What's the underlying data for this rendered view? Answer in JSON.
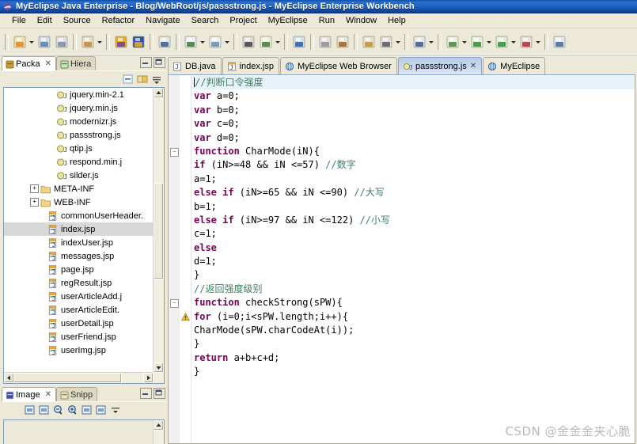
{
  "window": {
    "icon": "eclipse-icon",
    "title": "MyEclipse Java Enterprise - Blog/WebRoot/js/passstrong.js - MyEclipse Enterprise Workbench"
  },
  "menubar": {
    "items": [
      {
        "label": "File"
      },
      {
        "label": "Edit"
      },
      {
        "label": "Source"
      },
      {
        "label": "Refactor"
      },
      {
        "label": "Navigate"
      },
      {
        "label": "Search"
      },
      {
        "label": "Project"
      },
      {
        "label": "MyEclipse"
      },
      {
        "label": "Run"
      },
      {
        "label": "Window"
      },
      {
        "label": "Help"
      }
    ]
  },
  "toolbar": {
    "groups": [
      {
        "buttons": [
          {
            "name": "new-wizard-button",
            "color": "#f0e0a8",
            "accent": "#e08a20",
            "arrow": true
          },
          {
            "name": "save-button",
            "color": "#cfd8e8",
            "accent": "#5a7fb0",
            "arrow": false
          },
          {
            "name": "print-button",
            "color": "#d8dce4",
            "accent": "#7d8ca0",
            "arrow": false
          }
        ]
      },
      {
        "buttons": [
          {
            "name": "open-type-button",
            "color": "#e8dcc0",
            "accent": "#c08840",
            "arrow": true
          }
        ]
      },
      {
        "buttons": [
          {
            "name": "myeclipse-deploy-button",
            "color": "#e8b020",
            "accent": "#7040a0",
            "arrow": false
          },
          {
            "name": "myeclipse-server-button",
            "color": "#3050a8",
            "accent": "#e8b020",
            "arrow": false
          }
        ]
      },
      {
        "buttons": [
          {
            "name": "open-web-browser-button",
            "color": "#dfe4ee",
            "accent": "#3a5a8c",
            "arrow": false
          }
        ]
      },
      {
        "buttons": [
          {
            "name": "new-java-class-button",
            "color": "#e6eef8",
            "accent": "#3a7a3a",
            "arrow": true
          },
          {
            "name": "new-java-package-button",
            "color": "#e6eef8",
            "accent": "#6a8ab0",
            "arrow": true
          }
        ]
      },
      {
        "buttons": [
          {
            "name": "search-button",
            "color": "#dcdcdc",
            "accent": "#404040",
            "arrow": false
          },
          {
            "name": "next-annotation-button",
            "color": "#e8f0d8",
            "accent": "#3a7a3a",
            "arrow": true
          }
        ]
      },
      {
        "buttons": [
          {
            "name": "globe-button",
            "color": "#cfe0ef",
            "accent": "#2a5f9e",
            "arrow": false
          }
        ]
      },
      {
        "buttons": [
          {
            "name": "back-button",
            "color": "#e0e0e0",
            "accent": "#909090",
            "arrow": false
          },
          {
            "name": "forward-button",
            "color": "#e6e0d0",
            "accent": "#a06020",
            "arrow": false
          }
        ]
      },
      {
        "buttons": [
          {
            "name": "open-perspective-button",
            "color": "#e8e0c8",
            "accent": "#c09030",
            "arrow": false
          },
          {
            "name": "zoom-button",
            "color": "#dcdcdc",
            "accent": "#5a5a5a",
            "arrow": true
          }
        ]
      },
      {
        "buttons": [
          {
            "name": "toggle-mark-occurrences-button",
            "color": "#dfe6f0",
            "accent": "#3a5a8c",
            "arrow": true
          }
        ]
      },
      {
        "buttons": [
          {
            "name": "external-tools-button",
            "color": "#e8f0dc",
            "accent": "#4a8a3a",
            "arrow": true
          },
          {
            "name": "run-button",
            "color": "#dff0d8",
            "accent": "#2f8f2f",
            "arrow": true
          },
          {
            "name": "debug-button",
            "color": "#dff0d8",
            "accent": "#2f8f2f",
            "arrow": true
          },
          {
            "name": "profile-button",
            "color": "#f0dcd8",
            "accent": "#b03030",
            "arrow": true
          }
        ]
      },
      {
        "buttons": [
          {
            "name": "open-task-button",
            "color": "#dfe8f4",
            "accent": "#4a6a9a",
            "arrow": false
          }
        ]
      }
    ]
  },
  "left_panel": {
    "top_view": {
      "tabs": [
        {
          "label": "Packa",
          "icon": "package-explorer-icon",
          "active": true,
          "closable": true
        },
        {
          "label": "Hiera",
          "icon": "hierarchy-icon",
          "active": false,
          "closable": false
        }
      ],
      "controls": [
        {
          "name": "minimize-view-button",
          "glyph": "minimize-icon"
        },
        {
          "name": "maximize-view-button",
          "glyph": "maximize-icon"
        }
      ],
      "view_toolbar": [
        {
          "name": "collapse-all-button",
          "icon": "collapse-all-icon"
        },
        {
          "name": "link-with-editor-button",
          "icon": "link-editor-icon"
        },
        {
          "name": "view-menu-button",
          "icon": "view-menu-icon"
        }
      ],
      "tree": [
        {
          "label": "jquery.min-2.1",
          "icon": "js-file-icon",
          "indent": 5,
          "expander": "none",
          "selected": false
        },
        {
          "label": "jquery.min.js",
          "icon": "js-file-icon",
          "indent": 5,
          "expander": "none",
          "selected": false
        },
        {
          "label": "modernizr.js",
          "icon": "js-file-icon",
          "indent": 5,
          "expander": "none",
          "selected": false
        },
        {
          "label": "passstrong.js",
          "icon": "js-file-icon",
          "indent": 5,
          "expander": "none",
          "selected": false
        },
        {
          "label": "qtip.js",
          "icon": "js-file-icon",
          "indent": 5,
          "expander": "none",
          "selected": false
        },
        {
          "label": "respond.min.j",
          "icon": "js-file-icon",
          "indent": 5,
          "expander": "none",
          "selected": false
        },
        {
          "label": "silder.js",
          "icon": "js-file-icon",
          "indent": 5,
          "expander": "none",
          "selected": false
        },
        {
          "label": "META-INF",
          "icon": "folder-icon",
          "indent": 3,
          "expander": "plus",
          "selected": false
        },
        {
          "label": "WEB-INF",
          "icon": "folder-icon",
          "indent": 3,
          "expander": "plus",
          "selected": false
        },
        {
          "label": "commonUserHeader.",
          "icon": "jsp-file-icon",
          "indent": 4,
          "expander": "none",
          "selected": false
        },
        {
          "label": "index.jsp",
          "icon": "jsp-file-icon",
          "indent": 4,
          "expander": "none",
          "selected": true
        },
        {
          "label": "indexUser.jsp",
          "icon": "jsp-file-icon",
          "indent": 4,
          "expander": "none",
          "selected": false
        },
        {
          "label": "messages.jsp",
          "icon": "jsp-file-icon",
          "indent": 4,
          "expander": "none",
          "selected": false
        },
        {
          "label": "page.jsp",
          "icon": "jsp-file-icon",
          "indent": 4,
          "expander": "none",
          "selected": false
        },
        {
          "label": "regResult.jsp",
          "icon": "jsp-file-icon",
          "indent": 4,
          "expander": "none",
          "selected": false
        },
        {
          "label": "userArticleAdd.j",
          "icon": "jsp-file-icon",
          "indent": 4,
          "expander": "none",
          "selected": false
        },
        {
          "label": "userArticleEdit.",
          "icon": "jsp-file-icon",
          "indent": 4,
          "expander": "none",
          "selected": false
        },
        {
          "label": "userDetail.jsp",
          "icon": "jsp-file-icon",
          "indent": 4,
          "expander": "none",
          "selected": false
        },
        {
          "label": "userFriend.jsp",
          "icon": "jsp-file-icon",
          "indent": 4,
          "expander": "none",
          "selected": false
        },
        {
          "label": "userImg.jsp",
          "icon": "jsp-file-icon",
          "indent": 4,
          "expander": "none",
          "selected": false
        }
      ]
    },
    "bottom_view": {
      "tabs": [
        {
          "label": "Image",
          "icon": "image-view-icon",
          "active": true,
          "closable": true
        },
        {
          "label": "Snipp",
          "icon": "snippets-icon",
          "active": false,
          "closable": false
        }
      ],
      "controls": [
        {
          "name": "minimize-view-button",
          "glyph": "minimize-icon"
        },
        {
          "name": "maximize-view-button",
          "glyph": "maximize-icon"
        }
      ],
      "view_toolbar": [
        {
          "name": "image-properties-button",
          "icon": "properties-icon"
        },
        {
          "name": "fit-image-button",
          "icon": "fit-image-icon"
        },
        {
          "name": "zoom-out-button",
          "icon": "zoom-out-icon"
        },
        {
          "name": "zoom-in-button",
          "icon": "zoom-in-icon"
        },
        {
          "name": "zoom-100-button",
          "icon": "zoom-100-icon"
        },
        {
          "name": "zoom-fit-button",
          "icon": "zoom-fit-icon"
        },
        {
          "name": "view-menu-button",
          "icon": "view-menu-icon"
        }
      ]
    }
  },
  "editor": {
    "tabs": [
      {
        "label": "DB.java",
        "icon": "java-file-icon",
        "active": false,
        "closable": false
      },
      {
        "label": "index.jsp",
        "icon": "jsp-file-icon",
        "active": false,
        "closable": false
      },
      {
        "label": "MyEclipse Web Browser",
        "icon": "web-browser-icon",
        "active": false,
        "closable": false
      },
      {
        "label": "passstrong.js",
        "icon": "js-file-icon",
        "active": true,
        "closable": true
      },
      {
        "label": "MyEclipse",
        "icon": "web-browser-icon",
        "active": false,
        "closable": false
      }
    ],
    "filename": "passstrong.js",
    "code_lines": [
      {
        "current": true,
        "fold": "none",
        "marker": "none",
        "tokens": [
          {
            "t": "//判断口令强度",
            "c": "cm"
          }
        ]
      },
      {
        "current": false,
        "fold": "none",
        "marker": "none",
        "tokens": [
          {
            "t": "var",
            "c": "kw"
          },
          {
            "t": " a=0;",
            "c": "pl"
          }
        ]
      },
      {
        "current": false,
        "fold": "none",
        "marker": "none",
        "tokens": [
          {
            "t": "var",
            "c": "kw"
          },
          {
            "t": " b=0;",
            "c": "pl"
          }
        ]
      },
      {
        "current": false,
        "fold": "none",
        "marker": "none",
        "tokens": [
          {
            "t": "var",
            "c": "kw"
          },
          {
            "t": " c=0;",
            "c": "pl"
          }
        ]
      },
      {
        "current": false,
        "fold": "none",
        "marker": "none",
        "tokens": [
          {
            "t": "var",
            "c": "kw"
          },
          {
            "t": " d=0;",
            "c": "pl"
          }
        ]
      },
      {
        "current": false,
        "fold": "collapse",
        "marker": "none",
        "tokens": [
          {
            "t": "function",
            "c": "kw"
          },
          {
            "t": " CharMode(iN){",
            "c": "pl"
          }
        ]
      },
      {
        "current": false,
        "fold": "none",
        "marker": "none",
        "tokens": [
          {
            "t": "if",
            "c": "kw"
          },
          {
            "t": " (iN>=48 && iN <=57) ",
            "c": "pl"
          },
          {
            "t": "//数字",
            "c": "cm"
          }
        ]
      },
      {
        "current": false,
        "fold": "none",
        "marker": "none",
        "tokens": [
          {
            "t": "a=1;",
            "c": "pl"
          }
        ]
      },
      {
        "current": false,
        "fold": "none",
        "marker": "none",
        "tokens": [
          {
            "t": "else if",
            "c": "kw"
          },
          {
            "t": " (iN>=65 && iN <=90) ",
            "c": "pl"
          },
          {
            "t": "//大写",
            "c": "cm"
          }
        ]
      },
      {
        "current": false,
        "fold": "none",
        "marker": "none",
        "tokens": [
          {
            "t": "b=1;",
            "c": "pl"
          }
        ]
      },
      {
        "current": false,
        "fold": "none",
        "marker": "none",
        "tokens": [
          {
            "t": "else if",
            "c": "kw"
          },
          {
            "t": " (iN>=97 && iN <=122) ",
            "c": "pl"
          },
          {
            "t": "//小写",
            "c": "cm"
          }
        ]
      },
      {
        "current": false,
        "fold": "none",
        "marker": "none",
        "tokens": [
          {
            "t": "c=1;",
            "c": "pl"
          }
        ]
      },
      {
        "current": false,
        "fold": "none",
        "marker": "none",
        "tokens": [
          {
            "t": "else",
            "c": "kw"
          }
        ]
      },
      {
        "current": false,
        "fold": "none",
        "marker": "none",
        "tokens": [
          {
            "t": "d=1;",
            "c": "pl"
          }
        ]
      },
      {
        "current": false,
        "fold": "none",
        "marker": "none",
        "tokens": [
          {
            "t": "}",
            "c": "pl"
          }
        ]
      },
      {
        "current": false,
        "fold": "none",
        "marker": "none",
        "tokens": [
          {
            "t": "//返回强度级别",
            "c": "cm"
          }
        ]
      },
      {
        "current": false,
        "fold": "collapse",
        "marker": "none",
        "tokens": [
          {
            "t": "function",
            "c": "kw"
          },
          {
            "t": " checkStrong(sPW){",
            "c": "pl"
          }
        ]
      },
      {
        "current": false,
        "fold": "none",
        "marker": "warning",
        "tokens": [
          {
            "t": "for",
            "c": "kw"
          },
          {
            "t": " (i=0;i<sPW.length;i++){",
            "c": "pl"
          }
        ]
      },
      {
        "current": false,
        "fold": "none",
        "marker": "none",
        "tokens": [
          {
            "t": "CharMode(sPW.charCodeAt(i));",
            "c": "pl"
          }
        ]
      },
      {
        "current": false,
        "fold": "none",
        "marker": "none",
        "tokens": [
          {
            "t": "}",
            "c": "pl"
          }
        ]
      },
      {
        "current": false,
        "fold": "none",
        "marker": "none",
        "tokens": [
          {
            "t": "return",
            "c": "kw"
          },
          {
            "t": " a+b+c+d;",
            "c": "pl"
          }
        ]
      },
      {
        "current": false,
        "fold": "none",
        "marker": "none",
        "tokens": [
          {
            "t": "}",
            "c": "pl"
          }
        ]
      }
    ]
  },
  "watermark": {
    "text": "CSDN @金金金夹心脆"
  },
  "colors": {
    "title_blue": "#1e5ec0",
    "chrome": "#ece9d8",
    "keyword": "#7f0055",
    "comment": "#3f7f5f",
    "active_tab": "#c9d9f0",
    "selection": "#d8d8d8"
  }
}
